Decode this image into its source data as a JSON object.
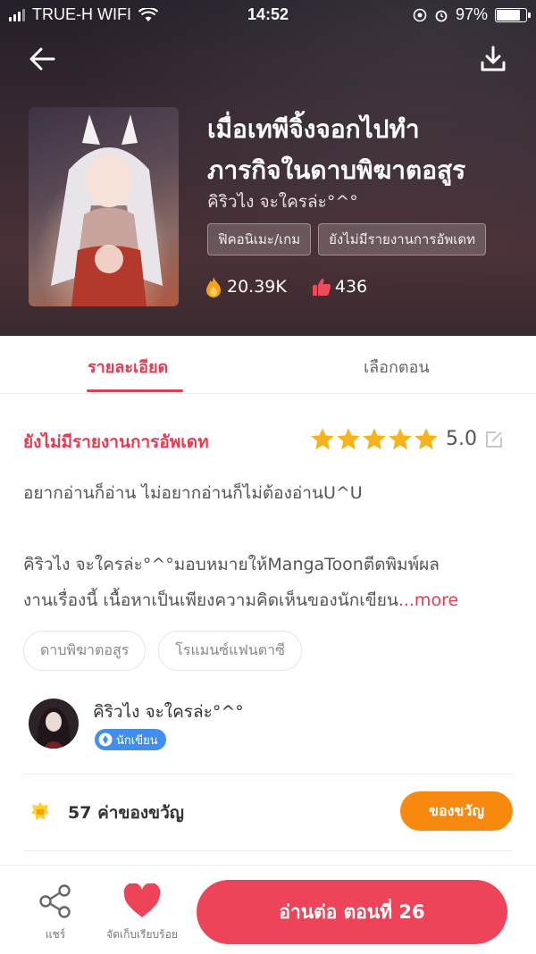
{
  "status_bar": {
    "carrier": "TRUE-H WIFI",
    "time": "14:52",
    "battery": "97%"
  },
  "header": {
    "back_icon": "arrow-left-icon",
    "download_icon": "download-icon",
    "title_line1": "เมื่อเทพีจิ้งจอกไปทำ",
    "title_line2": "ภารกิจในดาบพิฆาตอสูร",
    "author": "คิริวไง จะใครล่ะ°^°",
    "tags": [
      "ฟิคอนิเมะ/เกม",
      "ยังไม่มีรายงานการอัพเดท"
    ],
    "views": "20.39K",
    "likes": "436"
  },
  "tabs": {
    "details": "รายละเอียด",
    "episodes": "เลือกตอน"
  },
  "details": {
    "update_status": "ยังไม่มีรายงานการอัพเดท",
    "rating": "5.0",
    "rating_stars": 5,
    "description": "อยากอ่านก็อ่าน ไม่อยากอ่านก็ไม่ต้องอ่านU^U",
    "notice_line1": "คิริวไง จะใครล่ะ°^°มอบหมายให้MangaToonตีดพิมพ์ผล",
    "notice_line2": "งานเรื่องนี้ เนื้อหาเป็นเพียงความคิดเห็นของนักเขียน",
    "more": "...more",
    "genres": [
      "ดาบพิฆาตอสูร",
      "โรแมนซ์แฟนตาซี"
    ]
  },
  "author_card": {
    "name": "คิริวไง จะใครล่ะ°^°",
    "badge": "นักเขียน"
  },
  "gifts": {
    "count": "57",
    "label": "ค่าของขวัญ",
    "button": "ของขวัญ"
  },
  "bottom_bar": {
    "share": "แชร์",
    "favorite": "จัดเก็บเรียบร้อย",
    "read": "อ่านต่อ ตอนที่ 26"
  },
  "colors": {
    "accent": "#e83a50",
    "gift_button": "#f7890e",
    "read_button": "#ee4459",
    "badge": "#3f8ef0",
    "star": "#f6b31c"
  }
}
